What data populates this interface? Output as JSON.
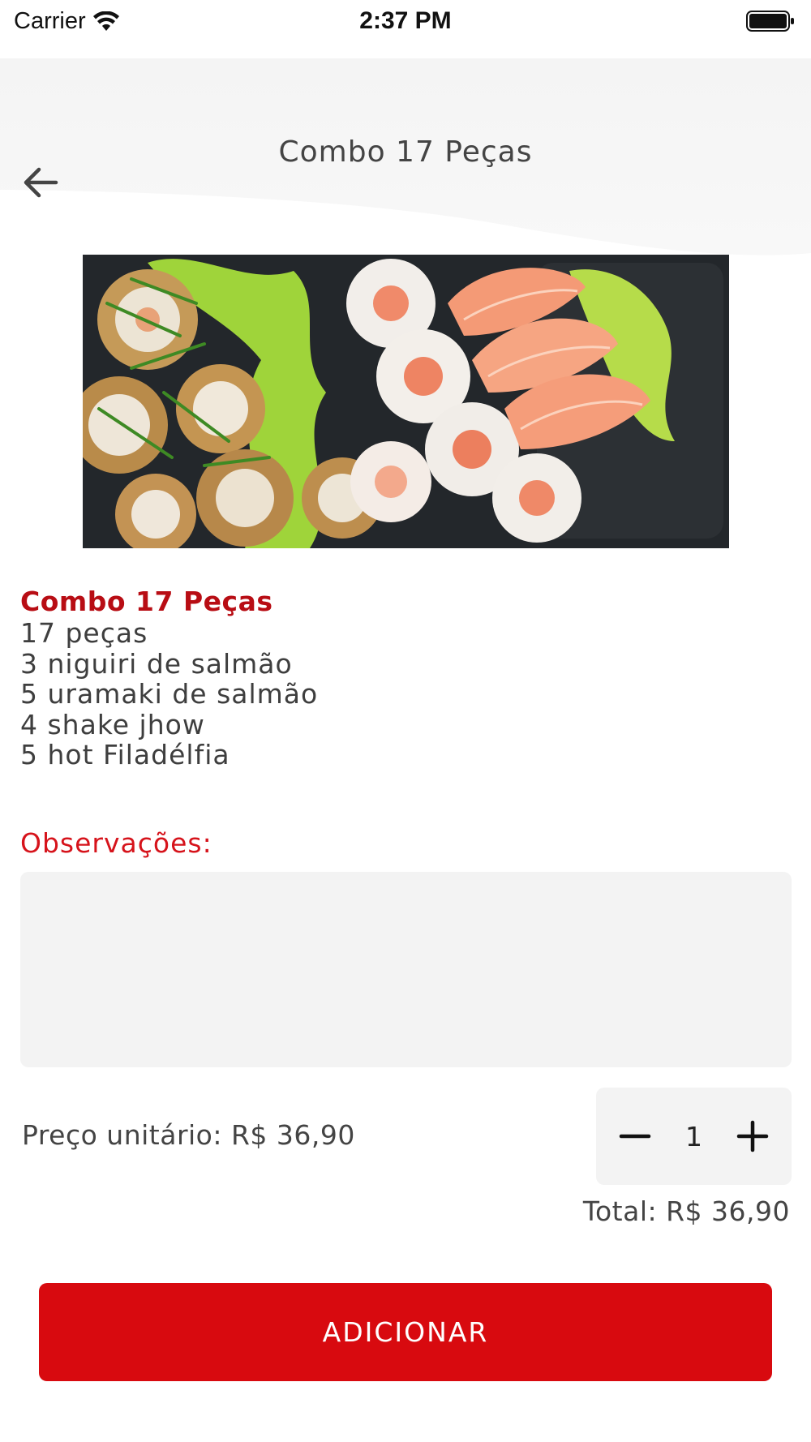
{
  "status_bar": {
    "carrier": "Carrier",
    "time": "2:37 PM"
  },
  "header": {
    "title": "Combo 17 Peças",
    "back_icon": "arrow-left-icon"
  },
  "product": {
    "title": "Combo 17 Peças",
    "lines": [
      "17 peças",
      "3 niguiri de salmão",
      "5 uramaki de salmão",
      "4 shake jhow",
      "5 hot Filadélfia"
    ]
  },
  "observations": {
    "label": "Observações:",
    "value": ""
  },
  "pricing": {
    "unit_price": "Preço unitário: R$ 36,90",
    "quantity": "1",
    "total": "Total: R$ 36,90"
  },
  "actions": {
    "add_label": "ADICIONAR"
  },
  "colors": {
    "accent": "#d80a0f",
    "title_red": "#b80d14",
    "header_bg": "#f4f4f4"
  }
}
